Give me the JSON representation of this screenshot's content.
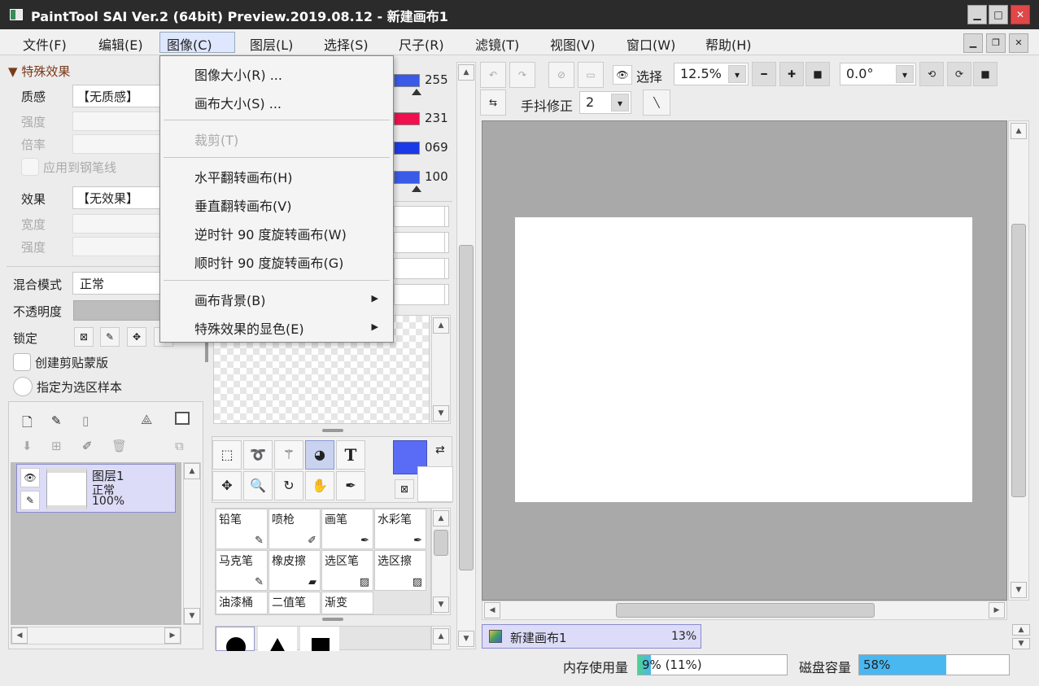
{
  "window": {
    "title": "PaintTool SAI Ver.2 (64bit) Preview.2019.08.12 - 新建画布1"
  },
  "menu": {
    "items": [
      "文件(F)",
      "编辑(E)",
      "图像(C)",
      "图层(L)",
      "选择(S)",
      "尺子(R)",
      "滤镜(T)",
      "视图(V)",
      "窗口(W)",
      "帮助(H)"
    ],
    "selected": 2
  },
  "dropdown": {
    "items": [
      "图像大小(R) ...",
      "画布大小(S) ...",
      "裁剪(T)",
      "水平翻转画布(H)",
      "垂直翻转画布(V)",
      "逆时针 90 度旋转画布(W)",
      "顺时针 90 度旋转画布(G)",
      "画布背景(B)",
      "特殊效果的显色(E)"
    ],
    "disabled": [
      2
    ],
    "submenu": [
      7,
      8
    ]
  },
  "effects": {
    "header": "特殊效果",
    "texture_label": "质感",
    "texture_value": "【无质感】",
    "strength_label": "强度",
    "scale_label": "倍率",
    "apply_pen": "应用到钢笔线",
    "effect_label": "效果",
    "effect_value": "【无效果】",
    "width_label": "宽度",
    "strength2_label": "强度"
  },
  "layer_props": {
    "blend_label": "混合模式",
    "blend_value": "正常",
    "opacity_label": "不透明度",
    "lock_label": "锁定",
    "clipping": "创建剪贴蒙版",
    "selection_source": "指定为选区样本"
  },
  "layer": {
    "name": "图层1",
    "mode": "正常",
    "opacity": "100%"
  },
  "color_values": [
    "255",
    "231",
    "069",
    "100"
  ],
  "colors": {
    "primary": "#5a6cf5",
    "h_bar": "#3a5ae8",
    "s_bar": "#f01050",
    "v_bar": "#1a3ae8",
    "a_bar": "#3a5ae8"
  },
  "brushes": [
    "铅笔",
    "喷枪",
    "画笔",
    "水彩笔",
    "马克笔",
    "橡皮擦",
    "选区笔",
    "选区擦",
    "油漆桶",
    "二值笔",
    "渐变"
  ],
  "toolbar": {
    "selection_label": "选择",
    "zoom": "12.5%",
    "angle": "0.0°",
    "stabilizer_label": "手抖修正",
    "stabilizer_value": "2"
  },
  "canvas_tab": {
    "name": "新建画布1",
    "zoom": "13%"
  },
  "status": {
    "memory_label": "内存使用量",
    "memory_value": "9% (11%)",
    "memory_fraction": 0.09,
    "disk_label": "磁盘容量",
    "disk_value": "58%",
    "disk_fraction": 0.58
  }
}
